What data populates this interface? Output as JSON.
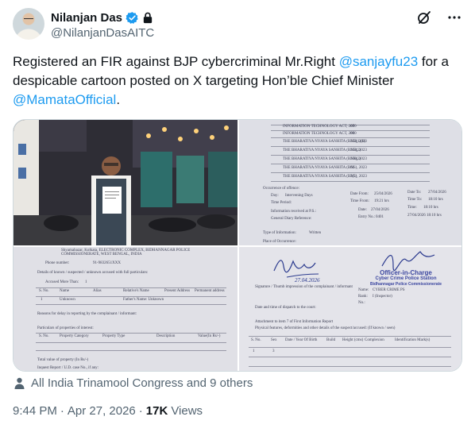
{
  "author": {
    "name": "Nilanjan Das",
    "handle": "@NilanjanDasAITC"
  },
  "tweet": {
    "text_prefix": "Registered an FIR against BJP cybercriminal Mr.Right ",
    "mention1": "@sanjayfu23",
    "text_middle": " for a despicable cartoon posted on X targeting Hon’ble Chief Minister ",
    "mention2": "@MamataOfficial",
    "text_suffix": "."
  },
  "media": {
    "doc_top_right": {
      "rows": [
        "INFORMATION TECHNOLOGY ACT, 2000",
        "INFORMATION TECHNOLOGY ACT, 2000",
        "THE BHARATIYA NYAYA SANHITA (BNS), 2023",
        "THE BHARATIYA NYAYA SANHITA (BNS), 2023",
        "THE BHARATIYA NYAYA SANHITA (BNS), 2023",
        "THE BHARATIYA NYAYA SANHITA (BNS), 2023",
        "THE BHARATIYA NYAYA SANHITA (BNS), 2023"
      ],
      "sections": [
        "67",
        "66",
        "353(1)(b)",
        "353(2)",
        "356(2)",
        "61",
        "3(5)"
      ],
      "occurrence_label": "Occurrence of offence:",
      "day_label": "Day:",
      "day": "Intervening Days",
      "date_from_label": "Date From:",
      "date_from": "25/04/2026",
      "date_to_label": "Date To:",
      "date_to": "27/04/2026",
      "time_period_label": "Time Period:",
      "time_from_label": "Time From:",
      "time_from": "19:21 hrs",
      "time_to_label": "Time To:",
      "time_to": "18:10 hrs",
      "info_received_label": "Information received at P.S.:",
      "info_date_label": "Date:",
      "info_date": "27/04/2026",
      "info_time_label": "Time:",
      "info_time": "18:10 hrs",
      "gd_label": "General Diary Reference:",
      "entry_no_label": "Entry No.:",
      "entry_no": "0401",
      "gd_date_time": "27/04/2026 18:10 hrs",
      "type_label": "Type of Information:",
      "type": "Written",
      "place_label": "Place of Occurrence:"
    },
    "doc_bottom_left": {
      "phone_label": "Phone number:",
      "phone": "91-9832651XXX",
      "address_line": "Shyamabazar, Kolkata, ELECTRONIC COMPLEX, BIDHANNAGAR POLICE COMMISSIONERATE, WEST BENGAL, INDIA",
      "suspect_label": "Details of known / suspected / unknown accused with full particulars:",
      "accused_label": "Accused More Than:",
      "accused_count": "1",
      "columns": [
        "S. No.",
        "Name",
        "Alias",
        "Relative's Name",
        "Present Address",
        "Permanent address"
      ],
      "row": [
        "1",
        "Unknown",
        "",
        "Father's Name: Unknown",
        "",
        ""
      ],
      "reasons_label": "Reasons for delay in reporting by the complainant / informant:",
      "property_label": "Particulars of properties of interest:",
      "prop_columns": [
        "S. No.",
        "Property Category",
        "Property Type",
        "Description",
        "Value(In Rs/-)"
      ],
      "inquest_label": "Inquest Report / U.D. case No., if any:",
      "total_value_label": "Total value of property (In Rs/-)"
    },
    "doc_bottom_right": {
      "signature": "Nilanjan Das",
      "sig_date": "27.04.2026",
      "signatory_label": "Signature / Thumb impression of the complainant / informant",
      "stamp_line1": "Officer-in-Charge",
      "stamp_line2": "Cyber Crime Police Station",
      "stamp_line3": "Bidhannagar Police Commissionerate",
      "name_label": "Name:",
      "name": "CYBER CRIME PS",
      "rank_label": "Rank:",
      "rank": "I (Inspector)",
      "no_label": "No.:",
      "dispatch_label": "Date and time of dispatch to the court:",
      "attachment_label": "Attachment to item 7 of First Information Report",
      "physical_label": "Physical features, deformities and other details of the suspect/accused: (If known / seen)",
      "columns": [
        "S. No.",
        "Sex",
        "Date / Year Of Birth",
        "Build",
        "Height (cms)",
        "Complexion",
        "Identification Mark(s)"
      ],
      "row_no": "1",
      "row_sex": "3"
    }
  },
  "social_context": "All India Trinamool Congress and 9 others",
  "meta": {
    "time": "9:44 PM",
    "separator": "·",
    "date": "Apr 27, 2026",
    "views_count": "17K",
    "views_label": "Views"
  },
  "colors": {
    "link": "#1d9bf0",
    "muted": "#536471",
    "text": "#0f1419",
    "verified": "#1d9bf0"
  }
}
